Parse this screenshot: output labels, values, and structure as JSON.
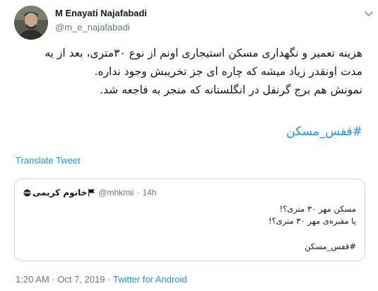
{
  "author": {
    "name": "M Enayati Najafabadi",
    "handle": "@m_e_najafabadi"
  },
  "tweet": {
    "lines": [
      "هزینه تعمیر و نگهداری مسکن استیجاری اونم از نوع  ۳۰متری، بعد از یه",
      "مدت اونقدر زیاد میشه که چاره ای جز تخریبش وجود نداره.",
      "نمونش هم برج گرنفل در انگلستانه که منجر به فاجعه شد."
    ],
    "hashtag": "#قفس_مسکن",
    "translate_label": "Translate Tweet"
  },
  "quoted": {
    "name": "خانوم کریمی",
    "handle": "@mhkmii",
    "separator": "·",
    "time": "14h",
    "lines": [
      "مسکن مهر ۳۰ متری؟!",
      "یا مقبره‌ی مهر ۳۰ متری؟!"
    ],
    "hashtag": "#قفس_مسکن"
  },
  "meta": {
    "time": "1:20 AM",
    "separator": "·",
    "date": "Oct 7, 2019",
    "source": "Twitter for Android"
  },
  "colors": {
    "link": "#1b95e0",
    "muted": "#657786",
    "border": "#ccd6dd"
  },
  "icons": [
    "avatar-photo",
    "chevron-down-icon",
    "ninja-emoji-icon",
    "black-flag-icon"
  ]
}
